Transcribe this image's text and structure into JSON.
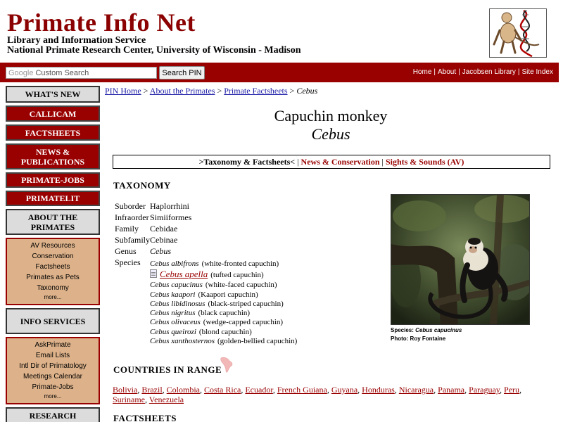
{
  "header": {
    "title": "Primate Info Net",
    "subtitle1": "Library and Information Service",
    "subtitle2": "National Primate Research Center, University of Wisconsin - Madison"
  },
  "search": {
    "google_label": "Google",
    "placeholder": "Custom Search",
    "button_label": "Search PIN"
  },
  "top_links": [
    "Home",
    "About",
    "Jacobsen Library",
    "Site Index"
  ],
  "sidebar": {
    "whats_new": "WHAT'S NEW",
    "callicam": "CALLICAM",
    "factsheets": "FACTSHEETS",
    "news": "NEWS & PUBLICATIONS",
    "jobs": "PRIMATE-JOBS",
    "primatelit": "PRIMATELIT",
    "about": "ABOUT THE PRIMATES",
    "about_items": [
      "AV Resources",
      "Conservation",
      "Factsheets",
      "Primates as Pets",
      "Taxonomy"
    ],
    "about_more": "more...",
    "info": "INFO SERVICES",
    "info_items": [
      "AskPrimate",
      "Email Lists",
      "Intl Dir of Primatology",
      "Meetings Calendar",
      "Primate-Jobs"
    ],
    "info_more": "more...",
    "research": "RESEARCH RESOURCES"
  },
  "breadcrumb": {
    "items": [
      "PIN Home",
      "About the Primates",
      "Primate Factsheets"
    ],
    "separator": ">",
    "current": "Cebus"
  },
  "page": {
    "common_name": "Capuchin monkey",
    "genus": "Cebus"
  },
  "tabs": {
    "taxonomy": ">Taxonomy & Factsheets<",
    "news": "News & Conservation",
    "sights": "Sights & Sounds (AV)"
  },
  "taxonomy": {
    "heading": "TAXONOMY",
    "rows": [
      {
        "key": "Suborder",
        "value": "Haplorrhini"
      },
      {
        "key": "Infraorder",
        "value": "Simiiformes"
      },
      {
        "key": "Family",
        "value": "Cebidae"
      },
      {
        "key": "Subfamily",
        "value": "Cebinae"
      },
      {
        "key": "Genus",
        "value": "Cebus"
      }
    ],
    "species_label": "Species",
    "species": [
      {
        "sci": "Cebus albifrons",
        "common": "(white-fronted capuchin)"
      },
      {
        "sci": "Cebus apella",
        "common": "(tufted capuchin)"
      },
      {
        "sci": "Cebus capucinus",
        "common": "(white-faced capuchin)"
      },
      {
        "sci": "Cebus kaapori",
        "common": "(Kaapori capuchin)"
      },
      {
        "sci": "Cebus libidinosus",
        "common": "(black-striped capuchin)"
      },
      {
        "sci": "Cebus nigritus",
        "common": "(black capuchin)"
      },
      {
        "sci": "Cebus olivaceus",
        "common": "(wedge-capped capuchin)"
      },
      {
        "sci": "Cebus queirozi",
        "common": "(blond capuchin)"
      },
      {
        "sci": "Cebus xanthosternos",
        "common": "(golden-bellied capuchin)"
      }
    ]
  },
  "photo": {
    "caption_label": "Species:",
    "caption_species": "Cebus capucinus",
    "credit": "Photo: Roy Fontaine"
  },
  "countries": {
    "heading": "COUNTRIES IN RANGE",
    "list": [
      "Bolivia",
      "Brazil",
      "Colombia",
      "Costa Rica",
      "Ecuador",
      "French Guiana",
      "Guyana",
      "Honduras",
      "Nicaragua",
      "Panama",
      "Paraguay",
      "Peru",
      "Suriname",
      "Venezuela"
    ]
  },
  "factsheets": {
    "heading": "FACTSHEETS"
  },
  "colors": {
    "brand_red": "#990000",
    "title_red": "#8b0000",
    "sidebar_tan": "#ddb28a",
    "link_blue": "#1a1aa6"
  }
}
